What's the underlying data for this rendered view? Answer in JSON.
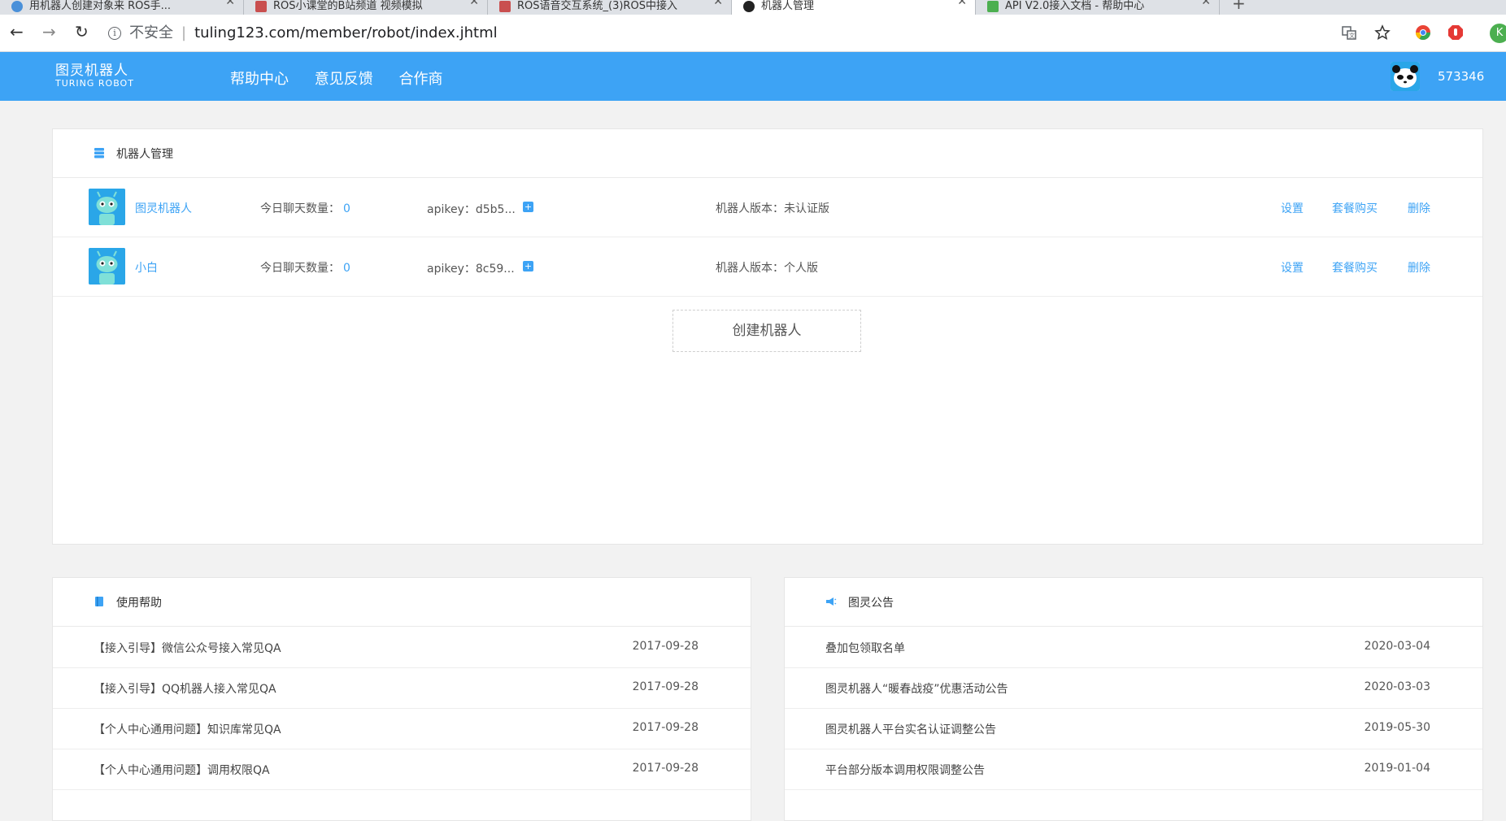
{
  "browser": {
    "tabs": [
      {
        "title": "用机器人创建对象来 ROS手... "
      },
      {
        "title": "ROS小课堂的B站频道 视频模拟"
      },
      {
        "title": "ROS语音交互系统_(3)ROS中接入"
      },
      {
        "title": "机器人管理"
      },
      {
        "title": "API V2.0接入文档 - 帮助中心"
      }
    ],
    "address": {
      "security_label": "不安全",
      "url": "tuling123.com/member/robot/index.jhtml"
    },
    "profile_initial": "K"
  },
  "header": {
    "logo_cn": "图灵机器人",
    "logo_en": "TURING ROBOT",
    "nav": [
      "帮助中心",
      "意见反馈",
      "合作商"
    ],
    "username": "573346"
  },
  "robot_panel": {
    "title": "机器人管理",
    "chat_label": "今日聊天数量：",
    "apikey_label": "apikey：",
    "version_label": "机器人版本：",
    "actions": [
      "设置",
      "套餐购买",
      "删除"
    ],
    "robots": [
      {
        "name": "图灵机器人",
        "chat_count": "0",
        "apikey": "d5b5...",
        "version": "未认证版"
      },
      {
        "name": "小白",
        "chat_count": "0",
        "apikey": "8c59...",
        "version": "个人版"
      }
    ],
    "create_button": "创建机器人"
  },
  "help_panel": {
    "title": "使用帮助",
    "items": [
      {
        "title": "【接入引导】微信公众号接入常见QA",
        "date": "2017-09-28"
      },
      {
        "title": "【接入引导】QQ机器人接入常见QA",
        "date": "2017-09-28"
      },
      {
        "title": "【个人中心通用问题】知识库常见QA",
        "date": "2017-09-28"
      },
      {
        "title": "【个人中心通用问题】调用权限QA",
        "date": "2017-09-28"
      }
    ]
  },
  "notice_panel": {
    "title": "图灵公告",
    "items": [
      {
        "title": "叠加包领取名单",
        "date": "2020-03-04"
      },
      {
        "title": "图灵机器人“暖春战疫”优惠活动公告",
        "date": "2020-03-03"
      },
      {
        "title": "图灵机器人平台实名认证调整公告",
        "date": "2019-05-30"
      },
      {
        "title": "平台部分版本调用权限调整公告",
        "date": "2019-01-04"
      }
    ]
  },
  "colors": {
    "brand": "#3da3f5",
    "link": "#3da3f5",
    "page_bg": "#f2f2f2"
  }
}
